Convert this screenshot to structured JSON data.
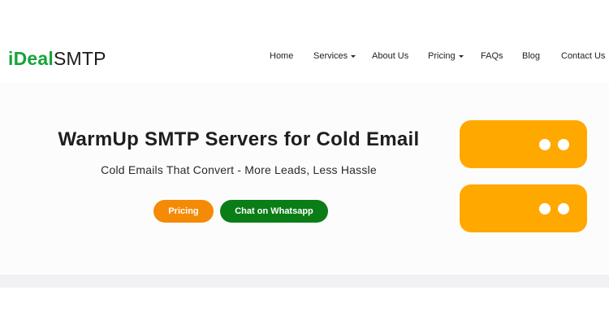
{
  "logo": {
    "ideal": "iDeal",
    "smtp": "SMTP"
  },
  "nav": {
    "home": "Home",
    "services": "Services",
    "about": "About Us",
    "pricing": "Pricing",
    "faqs": "FAQs",
    "blog": "Blog",
    "contact": "Contact Us"
  },
  "hero": {
    "title": "WarmUp SMTP Servers for Cold Email",
    "subtitle": "Cold Emails That Convert - More Leads, Less Hassle",
    "pricing_button": "Pricing",
    "whatsapp_button": "Chat on Whatsapp"
  },
  "colors": {
    "brand_green": "#17a33a",
    "pricing_orange": "#f58a07",
    "whatsapp_green": "#0b7d17",
    "server_orange": "#ffa800"
  },
  "icons": [
    "server-illustration",
    "chevron-down-icon"
  ]
}
